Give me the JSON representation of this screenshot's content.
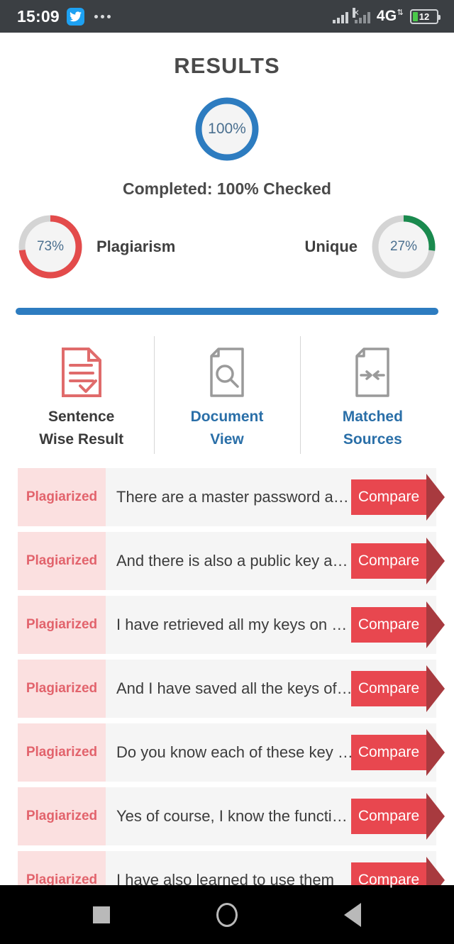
{
  "statusbar": {
    "time": "15:09",
    "app_icon": "twitter-icon",
    "overflow_icon": "more-dots-icon",
    "signal_icon": "signal-bars-icon",
    "network": "4G",
    "network_arrows": "↑↓",
    "battery_level": "12",
    "battery_icon": "battery-icon"
  },
  "header": {
    "title": "RESULTS",
    "overall": {
      "value_label": "100%",
      "percent": 100,
      "color": "#2d7cc0",
      "track_color": "#2d7cc0"
    },
    "completed_text": "Completed: 100% Checked"
  },
  "gauges": [
    {
      "name": "plagiarism",
      "value_label": "73%",
      "percent": 73,
      "label": "Plagiarism",
      "color": "#e34b4b",
      "track_color": "#d4d4d4"
    },
    {
      "name": "unique",
      "value_label": "27%",
      "percent": 27,
      "label": "Unique",
      "color": "#1a8a4e",
      "track_color": "#d4d4d4"
    }
  ],
  "progress_bar": {
    "percent": 100,
    "color": "#2d7cc0"
  },
  "tabs": [
    {
      "id": "sentence-wise-result",
      "line1": "Sentence",
      "line2": "Wise Result",
      "icon": "document-check-icon",
      "active": true,
      "icon_color": "#e06b6b",
      "label_color": "#3a3a3a"
    },
    {
      "id": "document-view",
      "line1": "Document",
      "line2": "View",
      "icon": "document-search-icon",
      "active": false,
      "icon_color": "#9a9a9a",
      "label_color": "#2a6fa8"
    },
    {
      "id": "matched-sources",
      "line1": "Matched",
      "line2": "Sources",
      "icon": "document-arrows-icon",
      "active": false,
      "icon_color": "#9a9a9a",
      "label_color": "#2a6fa8"
    }
  ],
  "results": {
    "compare_label": "Compare",
    "tag_label": "Plagiarized",
    "rows": [
      {
        "tag": "Plagiarized",
        "text": "There are a master password a…",
        "action": "Compare"
      },
      {
        "tag": "Plagiarized",
        "text": "And there is also a public key a…",
        "action": "Compare"
      },
      {
        "tag": "Plagiarized",
        "text": "I have retrieved all my keys on …",
        "action": "Compare"
      },
      {
        "tag": "Plagiarized",
        "text": "And I have saved all the keys of…",
        "action": "Compare"
      },
      {
        "tag": "Plagiarized",
        "text": "Do you know each of these key …",
        "action": "Compare"
      },
      {
        "tag": "Plagiarized",
        "text": "Yes of course, I know the functi…",
        "action": "Compare"
      },
      {
        "tag": "Plagiarized",
        "text": "I have also learned to use them",
        "action": "Compare"
      }
    ]
  },
  "navbar": {
    "recents": "recents-square-icon",
    "home": "home-circle-icon",
    "back": "back-triangle-icon"
  }
}
